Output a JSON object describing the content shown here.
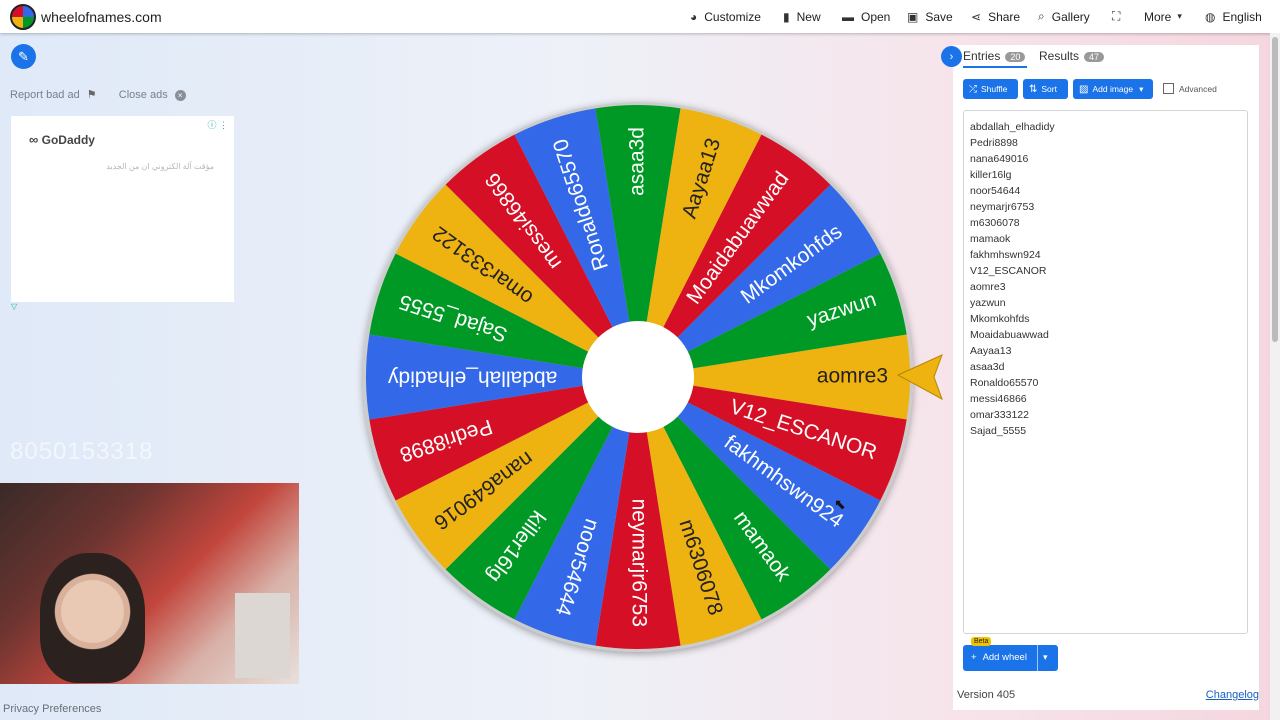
{
  "site": {
    "title": "wheelofnames.com"
  },
  "nav": [
    {
      "label": "Customize",
      "icon": "palette-icon",
      "glyph": "🎨"
    },
    {
      "label": "New",
      "icon": "file-icon",
      "glyph": "▮"
    },
    {
      "label": "Open",
      "icon": "folder-icon",
      "glyph": "▬"
    },
    {
      "label": "Save",
      "icon": "save-icon",
      "glyph": "▣"
    },
    {
      "label": "Share",
      "icon": "share-icon",
      "glyph": "⋖"
    },
    {
      "label": "Gallery",
      "icon": "search-icon",
      "glyph": "⌕"
    },
    {
      "label": "",
      "icon": "fullscreen-icon",
      "glyph": "⛶"
    },
    {
      "label": "More",
      "icon": "chevron-down-icon",
      "glyph": "▾"
    },
    {
      "label": "English",
      "icon": "globe-icon",
      "glyph": "◍"
    }
  ],
  "left": {
    "report_ad": "Report bad ad",
    "close_ads": "Close ads",
    "ad_brand": "GoDaddy",
    "ad_text": "مؤقت آلة الكتروني ان من الجديد",
    "ghost_number": "8050153318",
    "privacy": "Privacy Preferences"
  },
  "wheel": {
    "colors": [
      "#d50f25",
      "#3369e8",
      "#009925",
      "#eeb211"
    ],
    "pointer_color": "#eeb211",
    "segments": [
      "aomre3",
      "V12_ESCANOR",
      "fakhmhswn924",
      "mamaok",
      "m6306078",
      "neymarjr6753",
      "noor54644",
      "killer16lg",
      "nana649016",
      "Pedri8898",
      "abdallah_elhadidy",
      "Sajad_5555",
      "omar333122",
      "messi46866",
      "Ronaldo65570",
      "asaa3d",
      "Aayaa13",
      "Moaidabuawwad",
      "Mkomkohfds",
      "yazwun"
    ],
    "segment_colors": [
      "#eeb211",
      "#d50f25",
      "#3369e8",
      "#009925",
      "#eeb211",
      "#d50f25",
      "#3369e8",
      "#009925",
      "#eeb211",
      "#d50f25",
      "#3369e8",
      "#009925",
      "#eeb211",
      "#d50f25",
      "#3369e8",
      "#009925",
      "#eeb211",
      "#d50f25",
      "#3369e8",
      "#009925"
    ]
  },
  "panel": {
    "tabs": [
      {
        "label": "Entries",
        "count": "20"
      },
      {
        "label": "Results",
        "count": "47"
      }
    ],
    "shuffle": "Shuffle",
    "sort": "Sort",
    "add_image": "Add image",
    "advanced": "Advanced",
    "entries": [
      "abdallah_elhadidy",
      "Pedri8898",
      "nana649016",
      "killer16lg",
      "noor54644",
      "neymarjr6753",
      "m6306078",
      "mamaok",
      "fakhmhswn924",
      "V12_ESCANOR",
      "aomre3",
      "yazwun",
      "Mkomkohfds",
      "Moaidabuawwad",
      "Aayaa13",
      "asaa3d",
      "Ronaldo65570",
      "messi46866",
      "omar333122",
      "Sajad_5555"
    ],
    "beta": "Beta",
    "add_wheel": "Add wheel",
    "version": "Version 405",
    "changelog": "Changelog"
  }
}
